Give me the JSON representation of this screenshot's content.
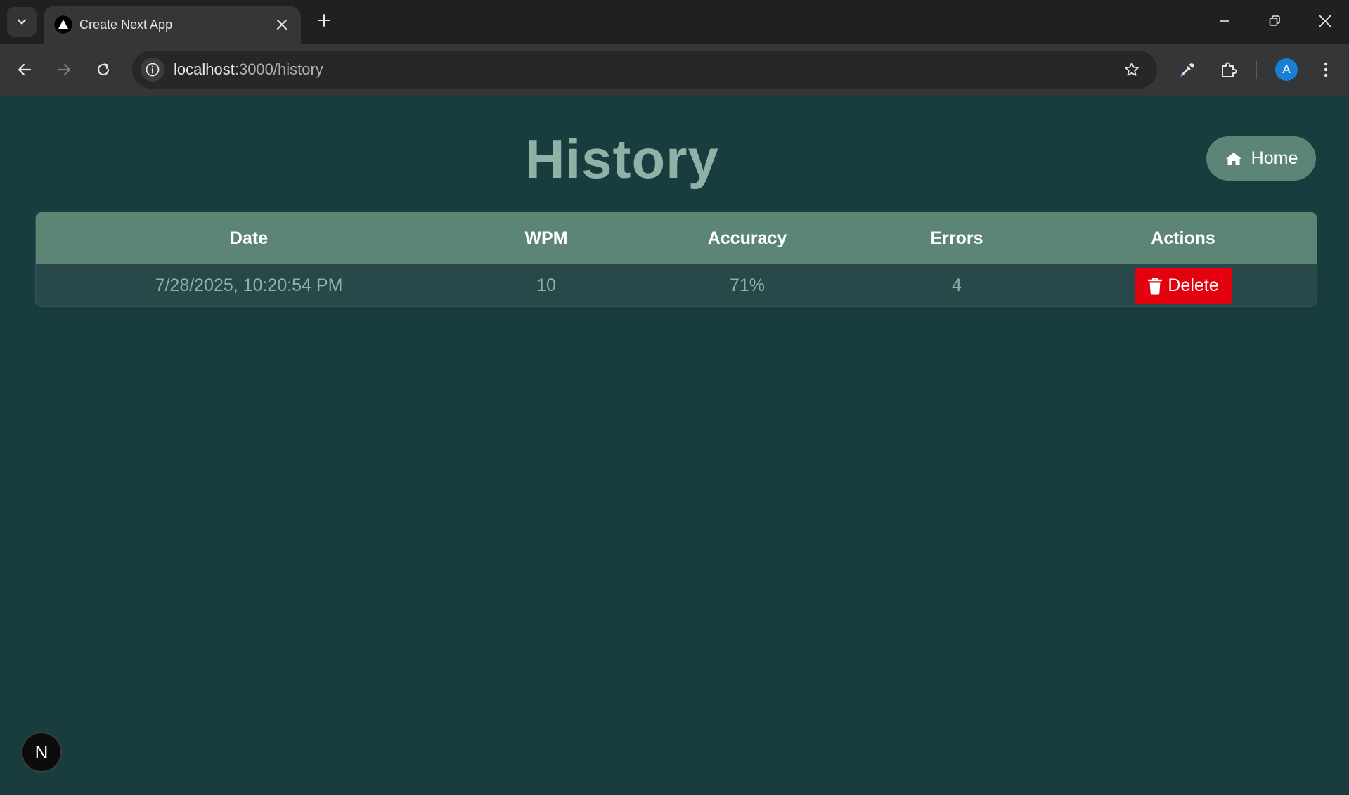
{
  "browser": {
    "tab_title": "Create Next App",
    "url_host": "localhost",
    "url_path": ":3000/history",
    "avatar_letter": "A"
  },
  "page": {
    "title": "History",
    "home_button_label": "Home",
    "table": {
      "columns": [
        "Date",
        "WPM",
        "Accuracy",
        "Errors",
        "Actions"
      ],
      "rows": [
        {
          "date": "7/28/2025, 10:20:54 PM",
          "wpm": "10",
          "accuracy": "71%",
          "errors": "4",
          "action_label": "Delete"
        }
      ]
    },
    "dev_badge_letter": "N"
  },
  "colors": {
    "background": "#193d3f",
    "accent": "#5d8576",
    "title": "#8fb2a6",
    "danger": "#e3000f"
  },
  "icons": {
    "tab_search": "chevron-down-icon",
    "favicon": "nextjs-triangle-icon",
    "home": "home-icon",
    "delete": "trash-icon"
  }
}
